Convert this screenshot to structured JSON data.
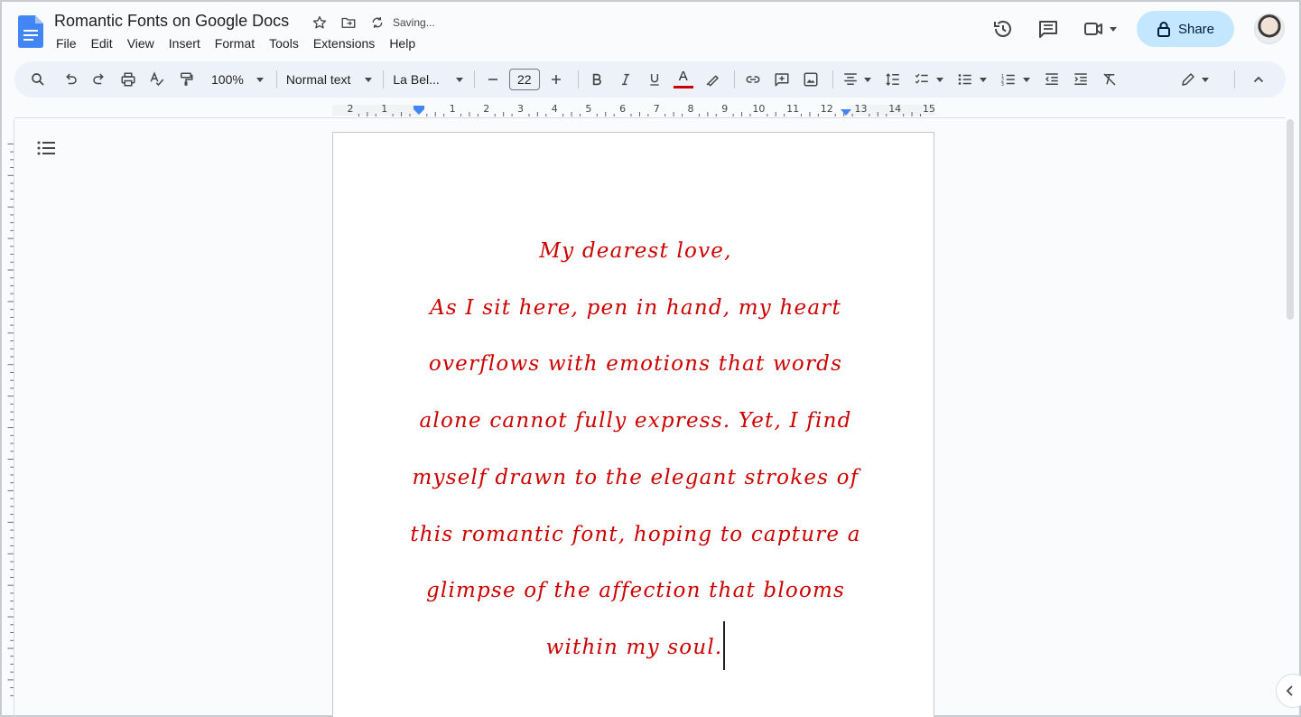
{
  "document": {
    "title": "Romantic Fonts on Google Docs",
    "save_status": "Saving..."
  },
  "menu": [
    "File",
    "Edit",
    "View",
    "Insert",
    "Format",
    "Tools",
    "Extensions",
    "Help"
  ],
  "header": {
    "share_label": "Share"
  },
  "toolbar": {
    "zoom": "100%",
    "style": "Normal text",
    "font": "La Bel...",
    "font_size": "22",
    "text_color": "#cc0000"
  },
  "ruler": {
    "labels": [
      "2",
      "1",
      "",
      "1",
      "2",
      "3",
      "4",
      "5",
      "6",
      "7",
      "8",
      "9",
      "10",
      "11",
      "12",
      "13",
      "14",
      "15"
    ]
  },
  "body": {
    "lines": [
      "My dearest love,",
      "As I sit here, pen in hand, my heart",
      "overflows with emotions that words",
      "alone cannot fully express. Yet, I find",
      "myself drawn to the elegant strokes of",
      "this romantic font, hoping to capture a",
      "glimpse of the affection that blooms",
      "within my soul."
    ]
  },
  "colors": {
    "accent": "#c2e7ff",
    "toolbar_bg": "#edf2fa",
    "text_red": "#cc0000"
  }
}
